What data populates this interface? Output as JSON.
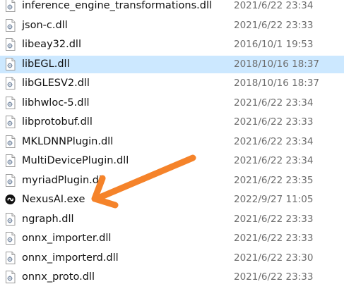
{
  "files": [
    {
      "name": "inference_engine_transformations.dll",
      "date": "2021/6/22 23:34",
      "icon": "dll-file-icon",
      "selected": false
    },
    {
      "name": "json-c.dll",
      "date": "2021/6/22 23:33",
      "icon": "dll-file-icon",
      "selected": false
    },
    {
      "name": "libeay32.dll",
      "date": "2016/10/1 19:53",
      "icon": "dll-file-icon",
      "selected": false
    },
    {
      "name": "libEGL.dll",
      "date": "2018/10/16 18:37",
      "icon": "dll-file-icon",
      "selected": true
    },
    {
      "name": "libGLESV2.dll",
      "date": "2018/10/16 18:37",
      "icon": "dll-file-icon",
      "selected": false
    },
    {
      "name": "libhwloc-5.dll",
      "date": "2021/6/22 23:34",
      "icon": "dll-file-icon",
      "selected": false
    },
    {
      "name": "libprotobuf.dll",
      "date": "2021/6/22 23:33",
      "icon": "dll-file-icon",
      "selected": false
    },
    {
      "name": "MKLDNNPlugin.dll",
      "date": "2021/6/22 23:34",
      "icon": "dll-file-icon",
      "selected": false
    },
    {
      "name": "MultiDevicePlugin.dll",
      "date": "2021/6/22 23:34",
      "icon": "dll-file-icon",
      "selected": false
    },
    {
      "name": "myriadPlugin.dll",
      "date": "2021/6/22 23:35",
      "icon": "dll-file-icon",
      "selected": false
    },
    {
      "name": "NexusAI.exe",
      "date": "2022/9/27 11:05",
      "icon": "nexusai-app-icon",
      "selected": false
    },
    {
      "name": "ngraph.dll",
      "date": "2021/6/22 23:33",
      "icon": "dll-file-icon",
      "selected": false
    },
    {
      "name": "onnx_importer.dll",
      "date": "2021/6/22 23:33",
      "icon": "dll-file-icon",
      "selected": false
    },
    {
      "name": "onnx_importerd.dll",
      "date": "2021/6/22 23:30",
      "icon": "dll-file-icon",
      "selected": false
    },
    {
      "name": "onnx_proto.dll",
      "date": "2021/6/22 23:33",
      "icon": "dll-file-icon",
      "selected": false
    }
  ],
  "colors": {
    "selection_background": "#cce8ff",
    "annotation_arrow": "#f5832a",
    "date_text": "#6d6d6d",
    "name_text": "#111111"
  }
}
